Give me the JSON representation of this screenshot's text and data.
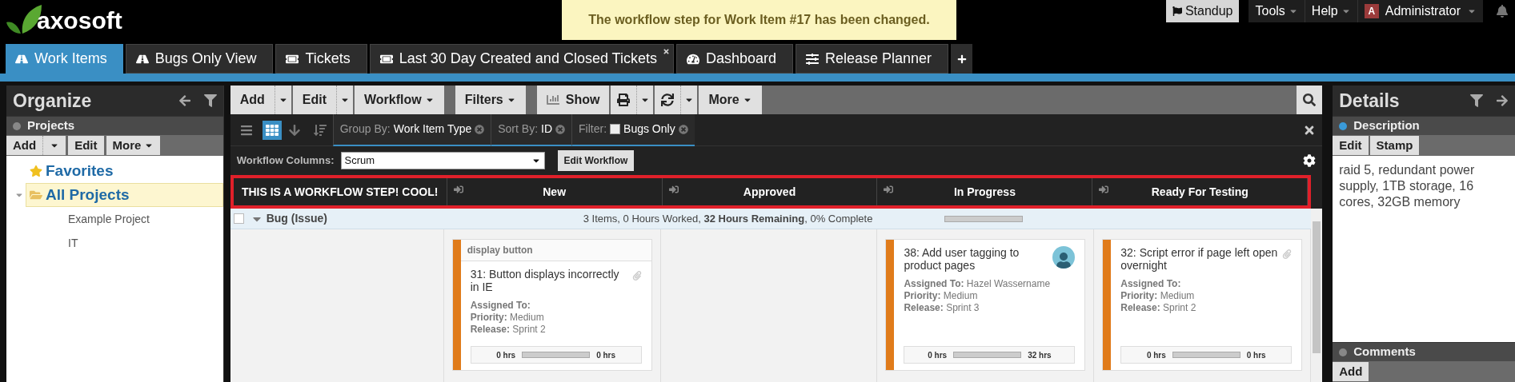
{
  "logo": {
    "text": "axosoft"
  },
  "notification": "The workflow step for Work Item #17 has been changed.",
  "top_menu": [
    {
      "label": "Standup",
      "kind": "flag"
    },
    {
      "label": "Tools",
      "kind": "menu"
    },
    {
      "label": "Help",
      "kind": "menu"
    },
    {
      "label": "Administrator",
      "kind": "user",
      "avatar_letter": "A"
    }
  ],
  "tabs": [
    {
      "label": "Work Items",
      "kind": "road",
      "selected": true,
      "closable": false
    },
    {
      "label": "Bugs Only View",
      "kind": "road",
      "selected": false,
      "closable": false
    },
    {
      "label": "Tickets",
      "kind": "ticket",
      "selected": false,
      "closable": false
    },
    {
      "label": "Last 30 Day Created and Closed Tickets",
      "kind": "ticket",
      "selected": false,
      "closable": true
    },
    {
      "label": "Dashboard",
      "kind": "gauge",
      "selected": false,
      "closable": false
    },
    {
      "label": "Release Planner",
      "kind": "sliders",
      "selected": false,
      "closable": false
    }
  ],
  "organize": {
    "title": "Organize",
    "section": {
      "title": "Projects",
      "active": false
    },
    "buttons": [
      {
        "label": "Add",
        "kind": "split"
      },
      {
        "label": "Edit",
        "kind": "plain"
      },
      {
        "label": "More",
        "kind": "menu"
      }
    ],
    "tree": [
      {
        "label": "Favorites",
        "kind": "star",
        "selected": false
      },
      {
        "label": "All Projects",
        "kind": "folder",
        "selected": true,
        "expanded": true,
        "children": [
          {
            "label": "Example Project",
            "selected": false
          },
          {
            "label": "IT",
            "selected": false
          }
        ]
      }
    ]
  },
  "toolbar": {
    "groups": [
      [
        {
          "label": "Add",
          "kind": "split"
        },
        {
          "label": "Edit",
          "kind": "split"
        },
        {
          "label": "Workflow",
          "kind": "menu"
        }
      ],
      [
        {
          "label": "Filters",
          "kind": "menu"
        }
      ],
      [
        {
          "label": "Show",
          "kind": "chart"
        },
        {
          "kind": "print"
        },
        {
          "kind": "refresh"
        },
        {
          "label": "More",
          "kind": "menu"
        }
      ]
    ]
  },
  "filter_bar": {
    "views": [
      {
        "kind": "list",
        "selected": false
      },
      {
        "kind": "grid",
        "selected": true
      }
    ],
    "chips": [
      {
        "label": "Group By:",
        "value": "Work Item Type",
        "kind": "value"
      },
      {
        "label": "Sort By:",
        "value": "ID",
        "kind": "value"
      },
      {
        "label": "Filter:",
        "value": "Bugs Only",
        "kind": "checkbox",
        "checked": false
      }
    ]
  },
  "workflow_columns": {
    "label": "Workflow Columns:",
    "value": "Scrum",
    "button": "Edit Workflow"
  },
  "board": {
    "columns": [
      {
        "label": "THIS IS A WORKFLOW STEP! COOL!",
        "collapsible": false
      },
      {
        "label": "New",
        "collapsible": true
      },
      {
        "label": "Approved",
        "collapsible": true
      },
      {
        "label": "In Progress",
        "collapsible": true
      },
      {
        "label": "Ready For Testing",
        "collapsible": true
      }
    ],
    "groups": [
      {
        "label": "Bug (Issue)",
        "expanded": true,
        "checked": false,
        "summary": "3 Items, 0 Hours Worked, **32 Hours Remaining**, 0% Complete",
        "level": 0,
        "lanes": [
          {
            "kind": "empty"
          },
          {
            "kind": "cards",
            "cards": [
              {
                "header": "display button",
                "title": "31: Button displays incorrectly in IE",
                "assigned_label": "Assigned To:",
                "priority_label": "Priority:",
                "priority": "Medium",
                "release_label": "Release:",
                "release": "Sprint 2",
                "hours_worked": "0 hrs",
                "hours_remaining": "0 hrs",
                "level": 0,
                "avatar": false,
                "attachment": true
              }
            ]
          },
          {
            "kind": "empty"
          },
          {
            "kind": "cards",
            "cards": [
              {
                "title": "38: Add user tagging to product pages",
                "assigned_label": "Assigned To:",
                "assigned": "Hazel Wassername",
                "priority_label": "Priority:",
                "priority": "Medium",
                "release_label": "Release:",
                "release": "Sprint 3",
                "hours_worked": "0 hrs",
                "hours_remaining": "32 hrs",
                "level": 0,
                "avatar": true,
                "attachment": false
              }
            ]
          },
          {
            "kind": "cards",
            "cards": [
              {
                "title": "32: Script error if page left open overnight",
                "assigned_label": "Assigned To:",
                "priority_label": "Priority:",
                "priority": "Medium",
                "release_label": "Release:",
                "release": "Sprint 2",
                "hours_worked": "0 hrs",
                "hours_remaining": "0 hrs",
                "level": 0,
                "avatar": false,
                "attachment": true
              }
            ]
          }
        ]
      }
    ]
  },
  "details": {
    "title": "Details",
    "sections": [
      {
        "title": "Description",
        "active": true,
        "buttons": [
          "Edit",
          "Stamp"
        ],
        "text": "raid 5, redundant power supply, 1TB storage, 16 cores, 32GB memory"
      },
      {
        "title": "Comments",
        "active": false,
        "buttons": [
          "Add"
        ]
      }
    ]
  }
}
